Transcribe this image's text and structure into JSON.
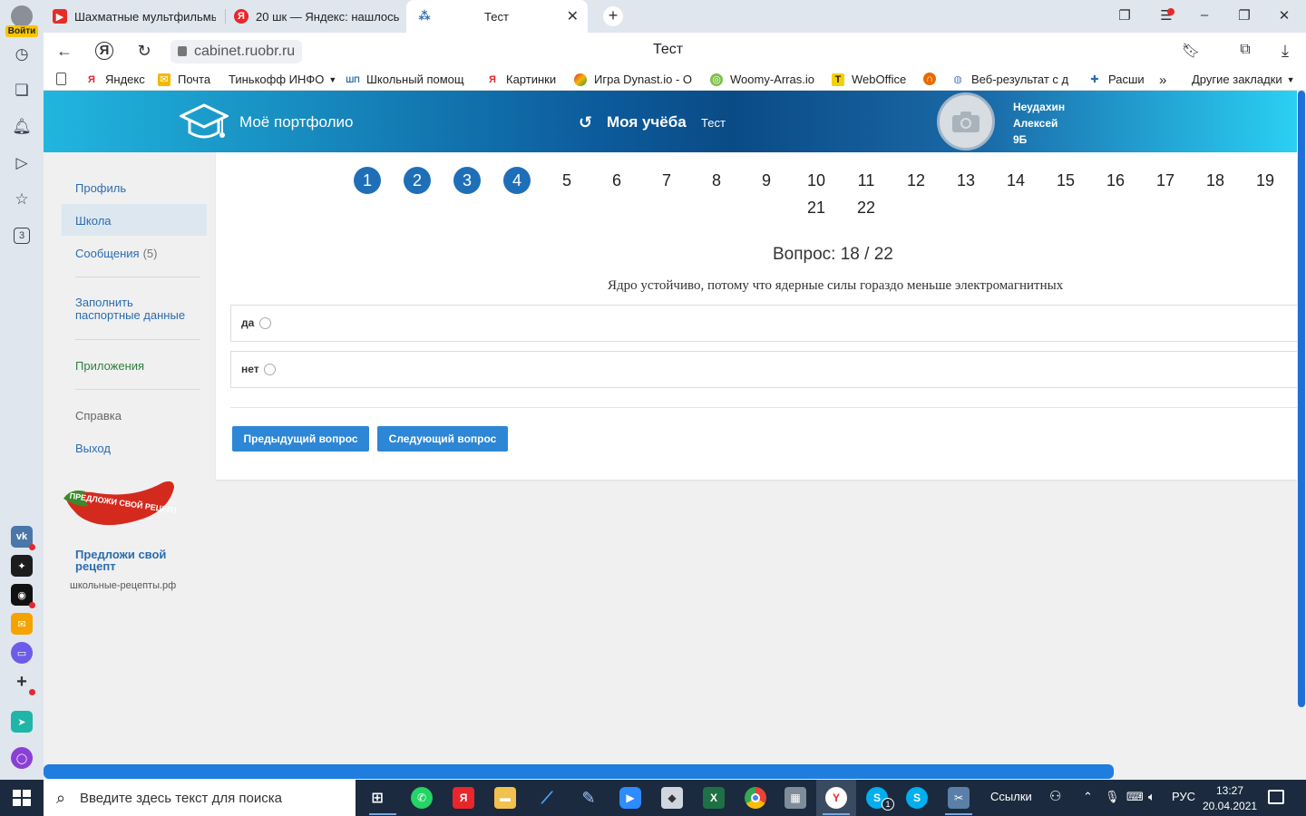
{
  "browser": {
    "login_label": "Войти",
    "tabs": [
      {
        "title": "Шахматные мультфильмы",
        "icon": "youtube-icon"
      },
      {
        "title": "20 шк — Яндекс: нашлось",
        "icon": "yandex-icon"
      },
      {
        "title": "Тест",
        "icon": "site-icon"
      }
    ],
    "url": "cabinet.ruobr.ru",
    "page_title": "Тест",
    "bookmarks": [
      {
        "label": "Яндекс",
        "icon": "yandex-icon"
      },
      {
        "label": "Почта",
        "icon": "mail-icon"
      },
      {
        "label": "Тинькофф ИНФО",
        "icon": "none"
      },
      {
        "label": "Школьный помощ",
        "icon": "school-helper-icon"
      },
      {
        "label": "Картинки",
        "icon": "yandex-icon"
      },
      {
        "label": "Игра Dynast.io - О",
        "icon": "dynast-icon"
      },
      {
        "label": "Woomy-Arras.io",
        "icon": "woomy-icon"
      },
      {
        "label": "WebOffice",
        "icon": "weboffice-icon"
      },
      {
        "label": "Веб-результат с д",
        "icon": "web-result-icon"
      },
      {
        "label": "Расши",
        "icon": "puzzle-icon"
      }
    ],
    "other_bookmarks": "Другие закладки",
    "rail_badge": "3"
  },
  "header": {
    "brand": "Моё портфолио",
    "study": "Моя учёба",
    "crumb": "Тест",
    "user": {
      "last_name": "Неудахин",
      "first_name": "Алексей",
      "class": "9Б"
    }
  },
  "sidebar": {
    "profile": "Профиль",
    "school": "Школа",
    "messages": "Сообщения",
    "messages_count": "(5)",
    "passport": "Заполнить паспортные данные",
    "apps": "Приложения",
    "help": "Справка",
    "logout": "Выход",
    "promo_image_text": "ПРЕДЛОЖИ СВОЙ РЕЦЕПТ",
    "promo_title": "Предложи свой рецепт",
    "promo_site": "школьные-рецепты.рф"
  },
  "quiz": {
    "question_numbers": [
      "1",
      "2",
      "3",
      "4",
      "5",
      "6",
      "7",
      "8",
      "9",
      "10",
      "11",
      "12",
      "13",
      "14",
      "15",
      "16",
      "17",
      "18",
      "19",
      "21",
      "22"
    ],
    "answered": [
      "1",
      "2",
      "3",
      "4"
    ],
    "heading": "Вопрос: 18 / 22",
    "question": "Ядро устойчиво, потому что ядерные силы гораздо меньше электромагнитных",
    "options": [
      "да",
      "нет"
    ],
    "prev_button": "Предыдущий вопрос",
    "next_button": "Следующий вопрос"
  },
  "taskbar": {
    "search_placeholder": "Введите здесь текст для поиска",
    "links_label": "Ссылки",
    "lang": "РУС",
    "time": "13:27",
    "date": "20.04.2021",
    "skype_badge": "1"
  }
}
